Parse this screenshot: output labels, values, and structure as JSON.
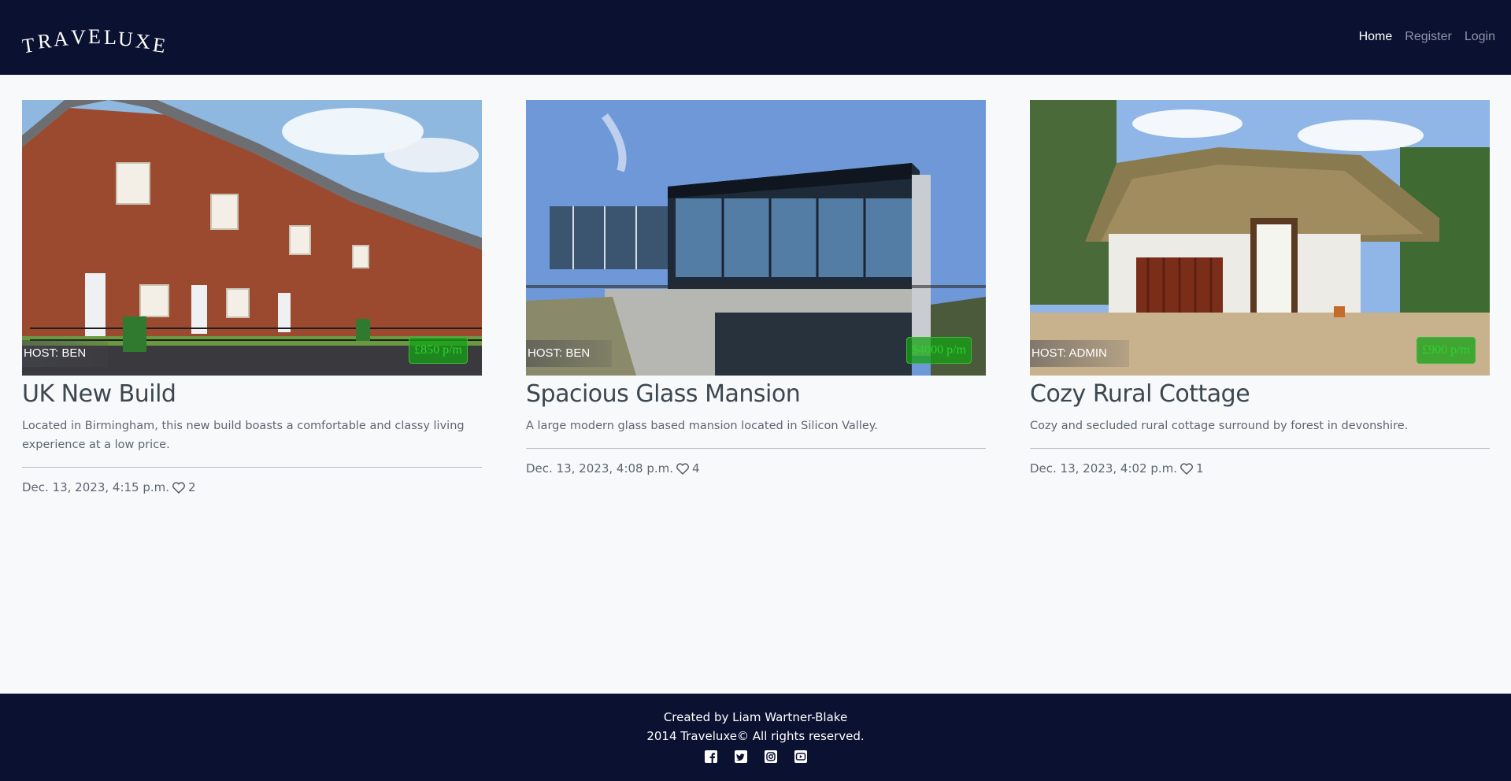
{
  "app": {
    "brand": "TRAVELUXE"
  },
  "nav": {
    "home": "Home",
    "register": "Register",
    "login": "Login"
  },
  "listings": [
    {
      "host": "HOST: BEN",
      "price": "£850 p/m",
      "title": "UK New Build",
      "description": "Located in Birmingham, this new build boasts a comfortable and classy living experience at a low price.",
      "date": "Dec. 13, 2023, 4:15 p.m.",
      "likes": "2"
    },
    {
      "host": "HOST: BEN",
      "price": "$4000 p/m",
      "title": "Spacious Glass Mansion",
      "description": "A large modern glass based mansion located in Silicon Valley.",
      "date": "Dec. 13, 2023, 4:08 p.m.",
      "likes": "4"
    },
    {
      "host": "HOST: ADMIN",
      "price": "£900 p/m",
      "title": "Cozy Rural Cottage",
      "description": "Cozy and secluded rural cottage surround by forest in devonshire.",
      "date": "Dec. 13, 2023, 4:02 p.m.",
      "likes": "1"
    }
  ],
  "footer": {
    "credit": "Created by Liam Wartner-Blake",
    "copyright": "2014 Traveluxe© All rights reserved.",
    "social": [
      "facebook-icon",
      "twitter-icon",
      "instagram-icon",
      "youtube-icon"
    ]
  },
  "colors": {
    "navbar": "#0b1130",
    "page_bg": "#f8f9fb",
    "price_badge": "#14a014"
  }
}
